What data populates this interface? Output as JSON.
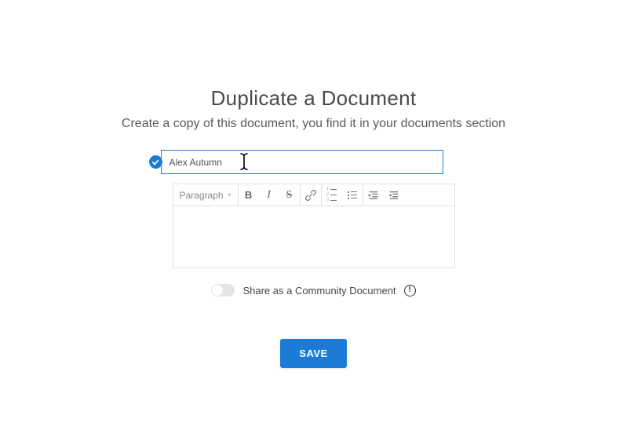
{
  "header": {
    "title": "Duplicate a Document",
    "subtitle": "Create a copy of this document, you find it in your documents section"
  },
  "form": {
    "title_value": "Alex Autumn",
    "validated": true
  },
  "editor": {
    "format_label": "Paragraph",
    "body_value": ""
  },
  "share": {
    "label": "Share as a Community Document",
    "enabled": false
  },
  "actions": {
    "save_label": "SAVE"
  },
  "colors": {
    "accent": "#1c7cd5"
  }
}
